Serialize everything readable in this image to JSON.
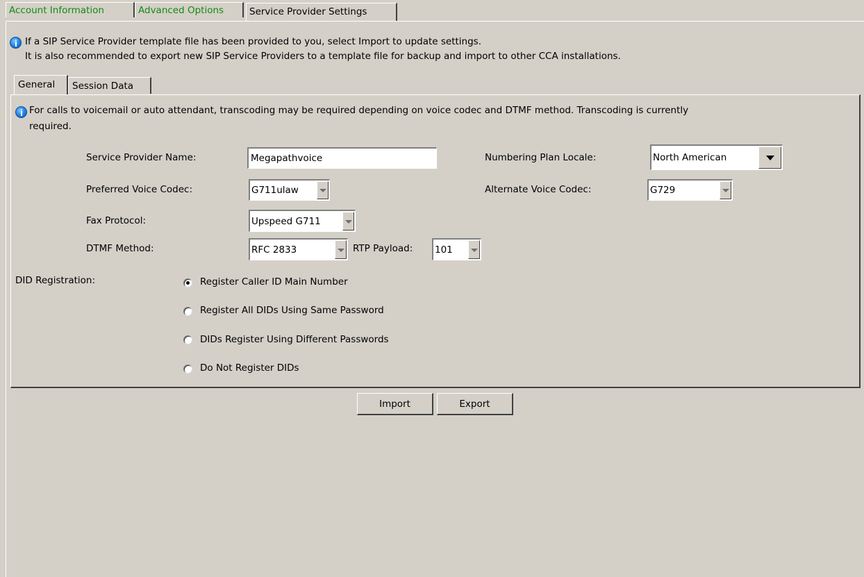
{
  "top_tabs": [
    {
      "label": "Account Information"
    },
    {
      "label": "Advanced Options"
    },
    {
      "label": "Service Provider Settings"
    }
  ],
  "notice_top": {
    "line1": "If a SIP Service Provider template file has been provided to you, select Import to update settings.",
    "line2": "It is also recommended to export new SIP Service Providers to a template file for backup and import to other CCA installations."
  },
  "inner_tabs": [
    {
      "label": "General"
    },
    {
      "label": "Session Data"
    }
  ],
  "notice_inner": {
    "line1": "For calls to voicemail or auto attendant, transcoding may be required depending on voice codec and DTMF method. Transcoding is currently",
    "line2": "required."
  },
  "form": {
    "provider_name_label": "Service Provider Name:",
    "provider_name_value": "Megapathvoice",
    "numbering_label": "Numbering Plan Locale:",
    "numbering_value": "North American",
    "pref_codec_label": "Preferred Voice Codec:",
    "pref_codec_value": "G711ulaw",
    "alt_codec_label": "Alternate Voice Codec:",
    "alt_codec_value": "G729",
    "fax_label": "Fax Protocol:",
    "fax_value": "Upspeed G711",
    "dtmf_label": "DTMF Method:",
    "dtmf_value": "RFC 2833",
    "rtp_label": "RTP Payload:",
    "rtp_value": "101"
  },
  "did": {
    "label": "DID Registration:",
    "options": [
      {
        "label": "Register Caller ID Main Number",
        "checked": true
      },
      {
        "label": "Register All DIDs Using Same Password",
        "checked": false
      },
      {
        "label": "DIDs Register Using Different Passwords",
        "checked": false
      },
      {
        "label": "Do Not Register DIDs",
        "checked": false
      }
    ]
  },
  "buttons": {
    "import": "Import",
    "export": "Export"
  },
  "colors": {
    "background": "#d4d0c8",
    "inactive_tab_text": "#138a13",
    "info_icon": "#1f7fe0"
  }
}
